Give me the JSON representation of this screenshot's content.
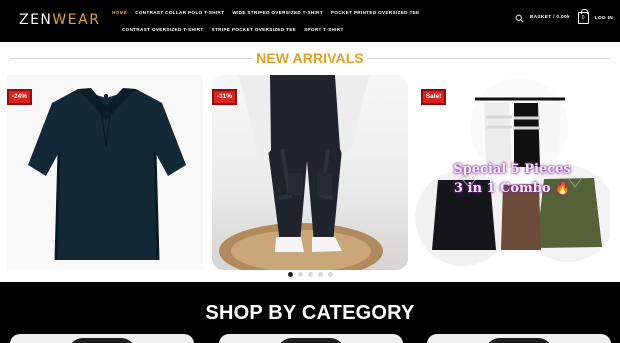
{
  "header": {
    "logo_part1": "ZEN",
    "logo_part2": "WEAR",
    "nav": [
      "HOME",
      "CONTRAST COLLAR POLO T-SHIRT",
      "WIDE STRIPED OVERSIZED T-SHIRT",
      "POCKET PRINTED OVERSIZED TEE",
      "CONTRAST OVERSIZED T-SHIRT",
      "STRIPE POCKET OVERSIZED TEE",
      "SPORT T-SHIRT"
    ],
    "basket_label": "BASKET / 0.00৳",
    "cart_count": "0",
    "login_label": "LOG IN"
  },
  "hero": {
    "title": "NEW ARRIVALS",
    "slides": [
      {
        "badge": "-24%",
        "image": "dark teal collared polo shirt"
      },
      {
        "badge": "-31%",
        "image": "person wearing black cargo jeans"
      },
      {
        "badge": "Sale!",
        "image": "special striped and plain shirts",
        "text_line1": "Special 5 Pieces",
        "text_line2": "3 in 1 Combo",
        "emoji": "🔥"
      }
    ],
    "dots": 5,
    "active_dot": 0
  },
  "category": {
    "title": "SHOP BY CATEGORY"
  },
  "colors": {
    "accent": "#e1a223",
    "header_bg": "#000000",
    "badge_bg": "#d8231f"
  },
  "icons": {
    "search": "search-icon",
    "cart": "shopping-bag-icon"
  }
}
